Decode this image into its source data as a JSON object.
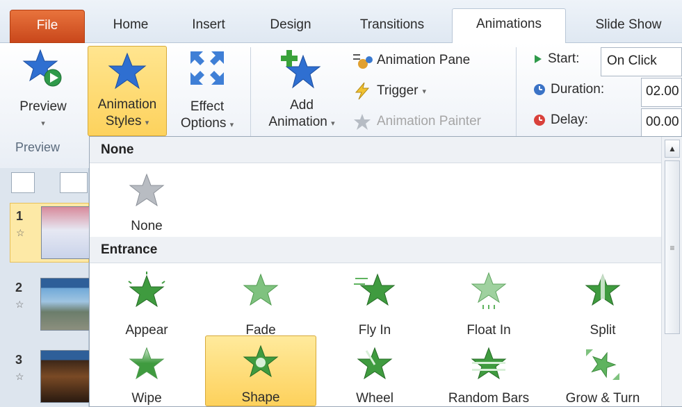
{
  "tabs": {
    "file": "File",
    "home": "Home",
    "insert": "Insert",
    "design": "Design",
    "transitions": "Transitions",
    "animations": "Animations",
    "slideshow": "Slide Show"
  },
  "ribbon": {
    "preview": {
      "label": "Preview",
      "caret": "▾"
    },
    "animation_styles": {
      "line1": "Animation",
      "line2": "Styles",
      "caret": "▾"
    },
    "effect_options": {
      "line1": "Effect",
      "line2": "Options",
      "caret": "▾"
    },
    "add_animation": {
      "line1": "Add",
      "line2": "Animation",
      "caret": "▾"
    },
    "animation_pane": "Animation Pane",
    "trigger": "Trigger",
    "trigger_caret": "▾",
    "animation_painter": "Animation Painter",
    "start_label": "Start:",
    "start_value": "On Click",
    "duration_label": "Duration:",
    "duration_value": "02.00",
    "delay_label": "Delay:",
    "delay_value": "00.00",
    "group_preview": "Preview"
  },
  "slides": [
    {
      "num": "1",
      "star": "☆"
    },
    {
      "num": "2",
      "star": "☆"
    },
    {
      "num": "3",
      "star": "☆"
    }
  ],
  "gallery": {
    "section_none": "None",
    "none_item": "None",
    "section_entrance": "Entrance",
    "entrance": [
      "Appear",
      "Fade",
      "Fly In",
      "Float In",
      "Split",
      "Wipe",
      "Shape",
      "Wheel",
      "Random Bars",
      "Grow & Turn"
    ],
    "selected": "Shape"
  },
  "colors": {
    "accent_blue": "#2f6fd1",
    "entrance_green": "#3f9b3f",
    "highlight": "#fdd25d",
    "file_tab": "#d9541e"
  }
}
